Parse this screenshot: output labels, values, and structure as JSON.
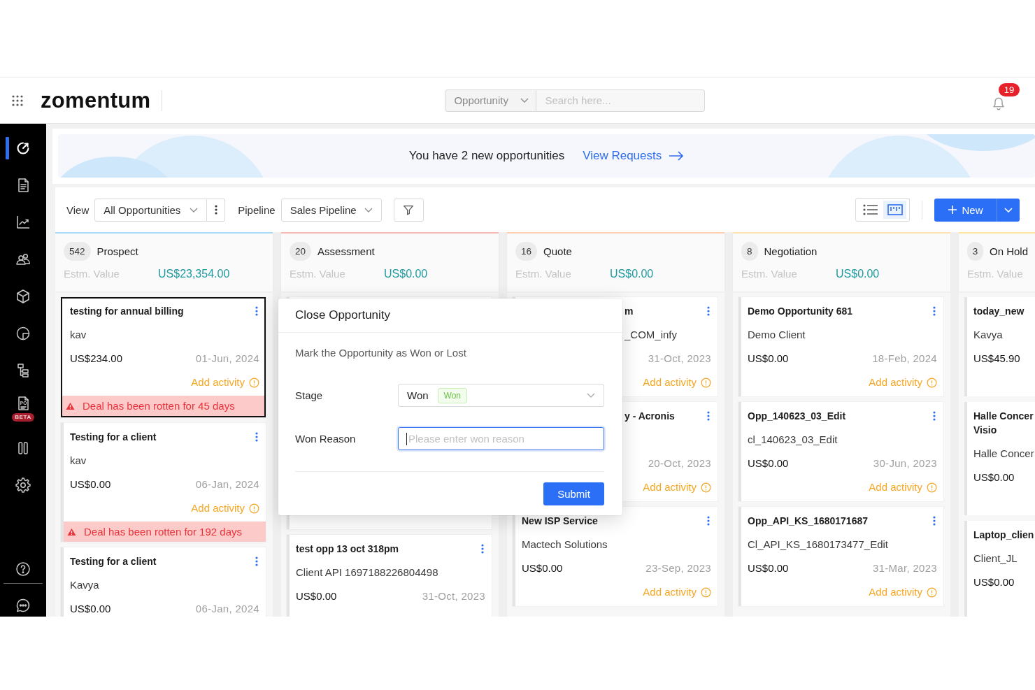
{
  "header": {
    "logo": "zomentum",
    "search": {
      "scope": "Opportunity",
      "placeholder": "Search here..."
    },
    "notification_count": "19"
  },
  "sidebar": {
    "items": [
      {
        "kind": "gauge",
        "selected": true
      },
      {
        "kind": "document",
        "selected": false
      },
      {
        "kind": "chart",
        "selected": false
      },
      {
        "kind": "people",
        "selected": false
      },
      {
        "kind": "cube",
        "selected": false
      },
      {
        "kind": "pie",
        "selected": false
      },
      {
        "kind": "tree",
        "selected": false
      },
      {
        "kind": "po",
        "selected": false,
        "icon_text": "PO",
        "badge": "BETA"
      },
      {
        "kind": "columns",
        "selected": false
      },
      {
        "kind": "gear",
        "selected": false
      }
    ],
    "footer_items": [
      {
        "kind": "help",
        "selected": false
      },
      {
        "kind": "chat",
        "selected": false
      }
    ]
  },
  "banner": {
    "message": "You have 2 new opportunities",
    "link": "View Requests"
  },
  "toolbar": {
    "view": {
      "label": "View",
      "value": "All Opportunities"
    },
    "pipeline": {
      "label": "Pipeline",
      "value": "Sales Pipeline"
    },
    "layouts": [
      {
        "kind": "list",
        "selected": false
      },
      {
        "kind": "board",
        "selected": true
      }
    ],
    "new_button": "New"
  },
  "columns": [
    {
      "count": "542",
      "name": "Prospect",
      "color": "#a3d9f4",
      "estimate_label": "Estm. Value",
      "estimate": "US$23,354.00",
      "cards": [
        {
          "kind": "full",
          "focused": true,
          "menu": true,
          "title": "testing for annual billing",
          "client": "kav",
          "amount": "US$234.00",
          "date": "01-Jun, 2024",
          "activity": "Add activity",
          "rotten": "Deal has been rotten for 45 days"
        },
        {
          "kind": "full",
          "focused": false,
          "menu": true,
          "title": "Testing for a client",
          "client": "kav",
          "amount": "US$0.00",
          "date": "06-Jan, 2024",
          "activity": "Add activity",
          "rotten": "Deal has been rotten for 192 days"
        },
        {
          "kind": "full",
          "focused": false,
          "menu": true,
          "title": "Testing for a client",
          "client": "Kavya",
          "amount": "US$0.00",
          "date": "06-Jan, 2024"
        }
      ]
    },
    {
      "count": "20",
      "name": "Assessment",
      "color": "#f8b6b0",
      "estimate_label": "Estm. Value",
      "estimate": "US$0.00",
      "cards": [
        {
          "kind": "hidden",
          "focused": false
        },
        {
          "kind": "full",
          "focused": false,
          "menu": true,
          "title": "test opp 13 oct 318pm",
          "client": "Client API 1697188226804498",
          "amount": "US$0.00",
          "date": "31-Oct, 2023"
        }
      ]
    },
    {
      "count": "16",
      "name": "Quote",
      "color": "#fccdb0",
      "estimate_label": "Estm. Value",
      "estimate": "US$0.00",
      "cards": [
        {
          "kind": "covered",
          "focused": false,
          "menu": true,
          "title": "m",
          "client": "_COM_infy",
          "date": "31-Oct, 2023",
          "activity": "Add activity"
        },
        {
          "kind": "covered",
          "focused": false,
          "menu": true,
          "title": "y - Acronis",
          "date": "20-Oct, 2023",
          "activity": "Add activity"
        },
        {
          "kind": "full",
          "focused": false,
          "menu": true,
          "title": "New ISP Service",
          "client": "Mactech Solutions",
          "amount": "US$0.00",
          "date": "23-Sep, 2023",
          "activity": "Add activity"
        }
      ]
    },
    {
      "count": "8",
      "name": "Negotiation",
      "color": "#fde2ad",
      "estimate_label": "Estm. Value",
      "estimate": "US$0.00",
      "cards": [
        {
          "kind": "full",
          "focused": false,
          "menu": true,
          "title": "Demo Opportunity 681",
          "client": "Demo Client",
          "amount": "US$0.00",
          "date": "18-Feb, 2024",
          "activity": "Add activity"
        },
        {
          "kind": "full",
          "focused": false,
          "menu": true,
          "title": "Opp_140623_03_Edit",
          "client": "cl_140623_03_Edit",
          "amount": "US$0.00",
          "date": "30-Jun, 2023",
          "activity": "Add activity"
        },
        {
          "kind": "full",
          "focused": false,
          "menu": true,
          "title": "Opp_API_KS_1680171687",
          "client": "Cl_API_KS_1680173477_Edit",
          "amount": "US$0.00",
          "date": "31-Mar, 2023",
          "activity": "Add activity"
        }
      ]
    },
    {
      "count": "3",
      "name": "On Hold",
      "color": "#fde598",
      "estimate_label": "Estm. Value",
      "cards": [
        {
          "kind": "full",
          "focused": false,
          "menu": false,
          "title": "today_new",
          "client": "Kavya",
          "amount": "US$45.90"
        },
        {
          "kind": "full",
          "focused": false,
          "menu": false,
          "title": "Halle Concer Visio",
          "client": "Halle Concer",
          "amount": "US$0.00"
        },
        {
          "kind": "full",
          "focused": false,
          "menu": false,
          "title": "Laptop_clien",
          "client": "Client_JL",
          "amount": "US$0.00"
        }
      ]
    }
  ],
  "dialog": {
    "title": "Close Opportunity",
    "subtitle": "Mark the Opportunity as Won or Lost",
    "fields": [
      {
        "kind": "select",
        "label": "Stage",
        "value": "Won",
        "tag": "Won"
      },
      {
        "kind": "text",
        "label": "Won Reason",
        "placeholder": "Please enter won reason",
        "focused": true
      }
    ],
    "submit": "Submit"
  }
}
